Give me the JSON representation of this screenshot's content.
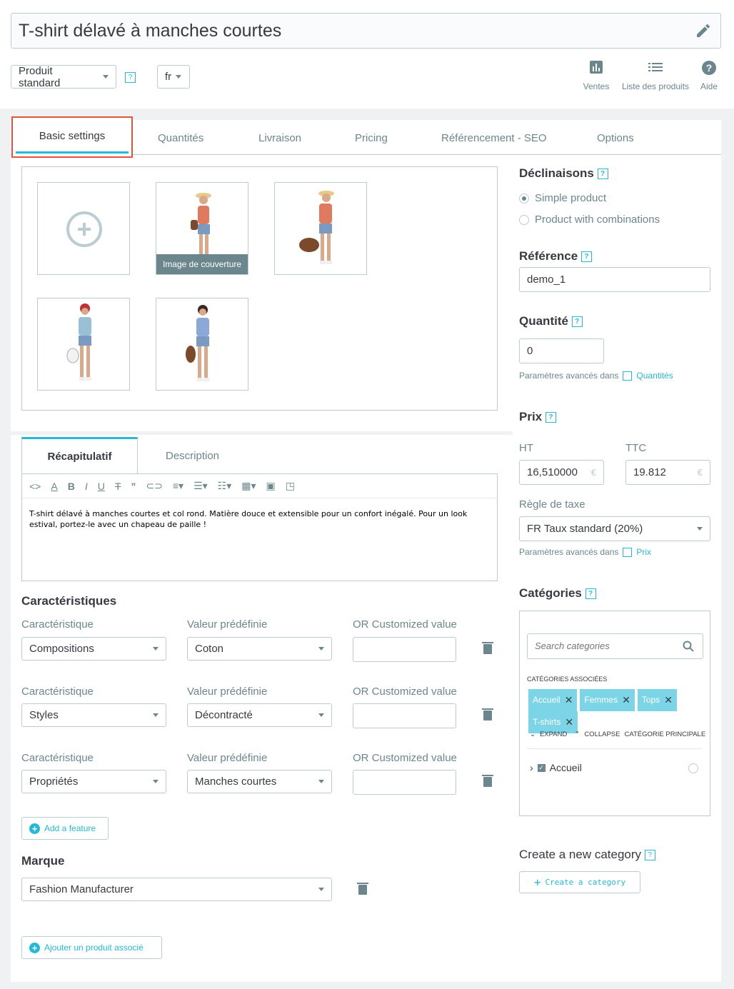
{
  "header": {
    "product_name": "T-shirt délavé à manches courtes",
    "product_type": "Produit standard",
    "language": "fr",
    "help_glyph": "?",
    "toolbar": [
      {
        "label": "Ventes",
        "icon": "bar-chart-icon"
      },
      {
        "label": "Liste des produits",
        "icon": "list-icon"
      },
      {
        "label": "Aide",
        "icon": "help-circle-icon"
      }
    ]
  },
  "tabs": [
    "Basic settings",
    "Quantités",
    "Livraison",
    "Pricing",
    "Référencement - SEO",
    "Options"
  ],
  "images": {
    "cover_label": "Image de couverture"
  },
  "editor": {
    "tabs": [
      "Récapitulatif",
      "Description"
    ],
    "content": "T-shirt délavé à manches courtes et col rond. Matière douce et extensible pour un confort inégalé. Pour un look estival, portez-le avec un chapeau de paille !"
  },
  "features": {
    "title": "Caractéristiques",
    "col_feature": "Caractéristique",
    "col_value": "Valeur prédéfinie",
    "col_custom": "OR Customized value",
    "rows": [
      {
        "feature": "Compositions",
        "value": "Coton"
      },
      {
        "feature": "Styles",
        "value": "Décontracté"
      },
      {
        "feature": "Propriétés",
        "value": "Manches courtes"
      }
    ],
    "add_label": "Add a feature"
  },
  "brand": {
    "title": "Marque",
    "value": "Fashion Manufacturer",
    "related_label": "Ajouter un produit associé"
  },
  "right": {
    "combinations_title": "Déclinaisons",
    "simple": "Simple product",
    "with_combinations": "Product with combinations",
    "reference_title": "Référence",
    "reference_value": "demo_1",
    "quantity_title": "Quantité",
    "quantity_value": "0",
    "advanced_in": "Paramètres avancés dans",
    "quantities_link": "Quantités",
    "price_title": "Prix",
    "ht_label": "HT",
    "ht_value": "16,510000",
    "ttc_label": "TTC",
    "ttc_value": "19.812",
    "currency": "€",
    "tax_label": "Règle de taxe",
    "tax_value": "FR Taux standard (20%)",
    "price_link": "Prix",
    "categories_title": "Catégories",
    "search_placeholder": "Search categories",
    "associated": "CATÉGORIES ASSOCIÉES",
    "tags": [
      "Accueil",
      "Femmes",
      "Tops",
      "T-shirts"
    ],
    "expand": "EXPAND",
    "collapse": "COLLAPSE",
    "main_category": "CATÉGORIE PRINCIPALE",
    "tree_root": "Accueil",
    "new_category_title": "Create a new category",
    "create_button": "Create a category"
  }
}
